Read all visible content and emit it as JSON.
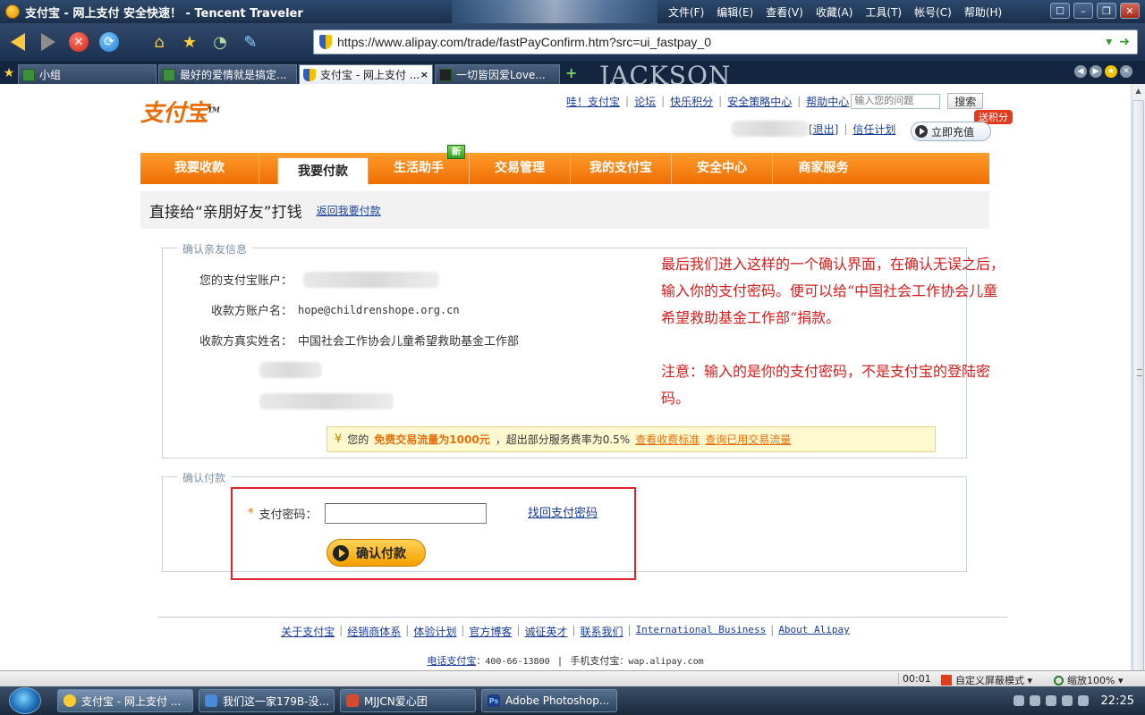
{
  "browser": {
    "title": "支付宝 - 网上支付 安全快速！ - Tencent Traveler",
    "menu": [
      "文件(F)",
      "编辑(E)",
      "查看(V)",
      "收藏(A)",
      "工具(T)",
      "帐号(C)",
      "帮助(H)"
    ],
    "url": "https://www.alipay.com/trade/fastPayConfirm.htm?src=ui_fastpay_0",
    "tabs": [
      {
        "label": "小组"
      },
      {
        "label": "最好的爱情就是搞定..."
      },
      {
        "label": "支付宝 - 网上支付 ..."
      },
      {
        "label": "一切皆因爱Love..."
      }
    ],
    "tab_banner": "JACKSON",
    "status": {
      "time": "00:01",
      "mode": "自定义屏蔽模式",
      "zoom": "缩放100%"
    }
  },
  "site": {
    "logo": "支付宝",
    "top_links": [
      "哇！支付宝",
      "论坛",
      "快乐积分",
      "安全策略中心",
      "帮助中心"
    ],
    "help_placeholder": "输入您的问题",
    "search_label": "搜索",
    "logout": "[退出]",
    "trust_plan": "信任计划",
    "recharge": "立即充值",
    "bonus_badge": "送积分",
    "nav": [
      {
        "label": "我要收款"
      },
      {
        "label": "我要付款"
      },
      {
        "label": "生活助手"
      },
      {
        "label": "交易管理"
      },
      {
        "label": "我的支付宝"
      },
      {
        "label": "安全中心"
      },
      {
        "label": "商家服务"
      }
    ],
    "nav_new_badge": "新"
  },
  "main": {
    "heading": "直接给“亲朋好友”打钱",
    "back_link": "返回我要付款",
    "friend_section": {
      "legend": "确认亲友信息",
      "account_label": "您的支付宝账户：",
      "payee_account_label": "收款方账户名：",
      "payee_account": "hope@childrenshope.org.cn",
      "payee_name_label": "收款方真实姓名：",
      "payee_name": "中国社会工作协会儿童希望救助基金工作部"
    },
    "notice": {
      "prefix": "您的",
      "highlight": "免费交易流量为1000元",
      "text": "，超出部分服务费率为0.5%",
      "link1": "查看收费标准",
      "link2": "查询已用交易流量"
    },
    "pay_section": {
      "legend": "确认付款",
      "required_mark": "*",
      "password_label": "支付密码：",
      "password_value": "",
      "find_password": "找回支付密码",
      "confirm_button": "确认付款"
    },
    "annotation": [
      "最后我们进入这样的一个确认界面，在确认无误之后，输入你的支付密码。便可以给“中国社会工作协会儿童希望救助基金工作部“捐款。",
      "注意：输入的是你的支付密码，不是支付宝的登陆密码。"
    ]
  },
  "footer": {
    "links": [
      "关于支付宝",
      "经销商体系",
      "体验计划",
      "官方博客",
      "诚征英才",
      "联系我们",
      "International Business",
      "About Alipay"
    ],
    "phone_label": "电话支付宝",
    "phone": "：400-66-13800",
    "mobile_label": "手机支付宝",
    "mobile": "：wap.alipay.com"
  },
  "taskbar": {
    "tasks": [
      {
        "label": "支付宝 - 网上支付 ..."
      },
      {
        "label": "我们这一家179B-没..."
      },
      {
        "label": "MJJCN爱心团"
      },
      {
        "label": "Adobe Photoshop..."
      }
    ],
    "clock": "22:25"
  },
  "colors": {
    "accent_orange": "#ef6d05",
    "annotation_red": "#d41c1c",
    "highlight_box": "#e0242a",
    "link_blue": "#1a3d99"
  }
}
